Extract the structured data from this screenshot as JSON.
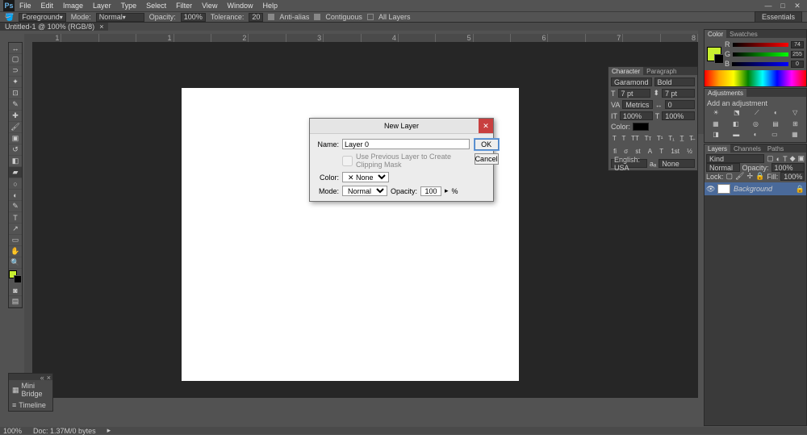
{
  "menu": [
    "File",
    "Edit",
    "Image",
    "Layer",
    "Type",
    "Select",
    "Filter",
    "View",
    "Window",
    "Help"
  ],
  "options": {
    "group": "Foreground",
    "mode_lbl": "Mode:",
    "mode": "Normal",
    "opacity_lbl": "Opacity:",
    "opacity": "100%",
    "tolerance_lbl": "Tolerance:",
    "tolerance": "20",
    "aa": "Anti-alias",
    "cont": "Contiguous",
    "all": "All Layers",
    "ess": "Essentials"
  },
  "doc": {
    "tab": "Untitled-1 @ 100% (RGB/8)"
  },
  "ruler": [
    "1",
    "",
    "",
    "1",
    "",
    "2",
    "",
    "3",
    "",
    "4",
    "",
    "5",
    "",
    "6",
    "",
    "7",
    "",
    "8"
  ],
  "dialog": {
    "title": "New Layer",
    "name_lbl": "Name:",
    "name": "Layer 0",
    "prev": "Use Previous Layer to Create Clipping Mask",
    "color_lbl": "Color:",
    "color": "✕ None",
    "mode_lbl": "Mode:",
    "mode": "Normal",
    "opac_lbl": "Opacity:",
    "opac": "100",
    "pct": "%",
    "ok": "OK",
    "cancel": "Cancel"
  },
  "color": {
    "tab1": "Color",
    "tab2": "Swatches",
    "r": "74",
    "g": "255",
    "b": "0"
  },
  "adj": {
    "tab": "Adjustments",
    "msg": "Add an adjustment"
  },
  "char": {
    "tab1": "Character",
    "tab2": "Paragraph",
    "font": "Garamond",
    "style": "Bold",
    "size": "7 pt",
    "lead": "7 pt",
    "kern": "Metrics",
    "track": "0",
    "scale": "100%",
    "base": "100%",
    "colorlbl": "Color:",
    "lang": "English: USA",
    "aa": "None"
  },
  "layers": {
    "tab1": "Layers",
    "tab2": "Channels",
    "tab3": "Paths",
    "kind": "Kind",
    "mode": "Normal",
    "opac_lbl": "Opacity:",
    "opac": "100%",
    "lock_lbl": "Lock:",
    "fill_lbl": "Fill:",
    "fill": "100%",
    "layer": "Background"
  },
  "minib": {
    "t1": "Mini Bridge",
    "t2": "Timeline"
  },
  "status": {
    "zoom": "100%",
    "doc": "Doc: 1.37M/0 bytes"
  }
}
